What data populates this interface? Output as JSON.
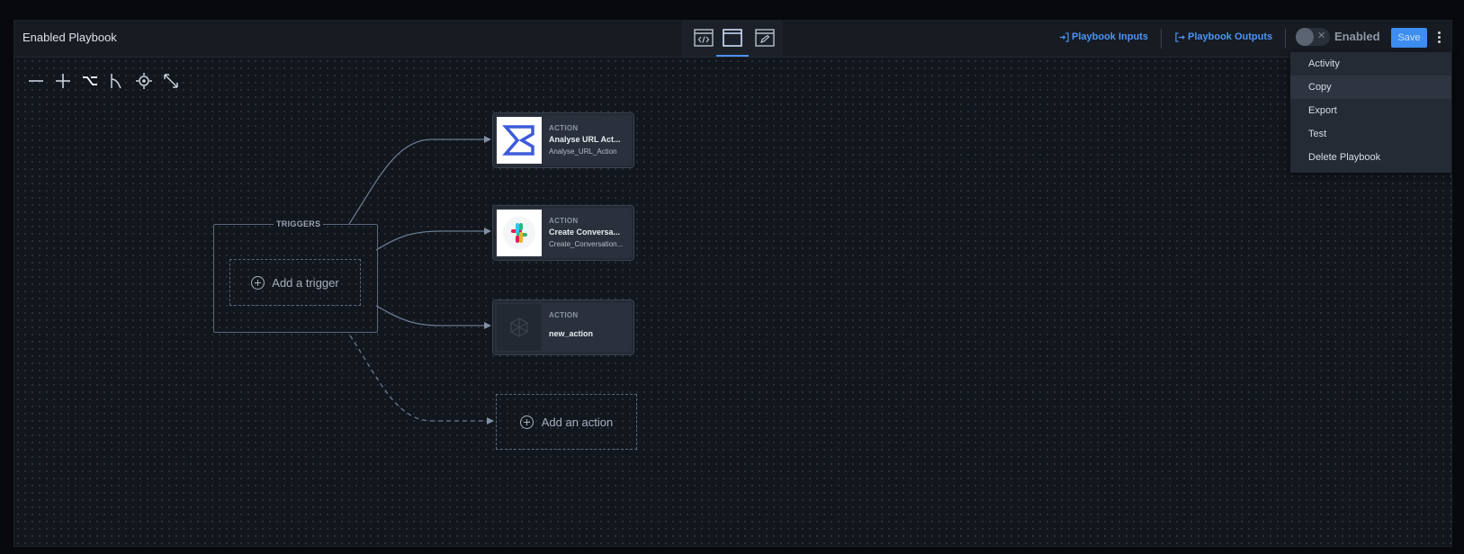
{
  "header": {
    "title": "Enabled Playbook",
    "playbook_inputs": "Playbook Inputs",
    "playbook_outputs": "Playbook Outputs",
    "toggle_state": "Enabled",
    "save_label": "Save"
  },
  "menu": {
    "items": [
      "Activity",
      "Copy",
      "Export",
      "Test",
      "Delete Playbook"
    ]
  },
  "canvas": {
    "triggers_label": "TRIGGERS",
    "add_trigger": "Add a trigger",
    "add_action": "Add an action",
    "actions": [
      {
        "kind": "ACTION",
        "name": "Analyse URL Act...",
        "sub": "Analyse_URL_Action",
        "icon": "sigma-icon"
      },
      {
        "kind": "ACTION",
        "name": "Create Conversa...",
        "sub": "Create_Conversation...",
        "icon": "slack-icon"
      },
      {
        "kind": "ACTION",
        "name": "new_action",
        "sub": "",
        "icon": "placeholder-icon"
      }
    ]
  },
  "colors": {
    "accent": "#4c95f5",
    "save_button": "#3d8ef0",
    "background": "#12161d"
  }
}
